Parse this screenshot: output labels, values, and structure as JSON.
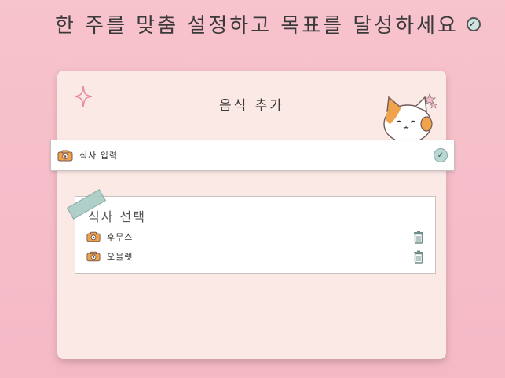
{
  "header": {
    "headline": "한 주를 맞춤 설정하고 목표를 달성하세요",
    "headline_icon": "check-circle-icon"
  },
  "card": {
    "title": "음식 추가",
    "decorations": [
      "sparkle-icon",
      "cat-icon"
    ]
  },
  "input": {
    "label": "식사 입력",
    "icon": "camera-icon",
    "submit_icon": "check-icon"
  },
  "meal_select": {
    "title": "식사 선택",
    "items": [
      {
        "name": "후무스",
        "icon": "camera-icon",
        "action_icon": "trash-icon"
      },
      {
        "name": "오믈렛",
        "icon": "camera-icon",
        "action_icon": "trash-icon"
      }
    ]
  },
  "colors": {
    "background": "#f7c3cd",
    "card": "#fbe9e6",
    "accent_teal": "#a7ccc4",
    "camera_orange": "#f0a14a"
  }
}
